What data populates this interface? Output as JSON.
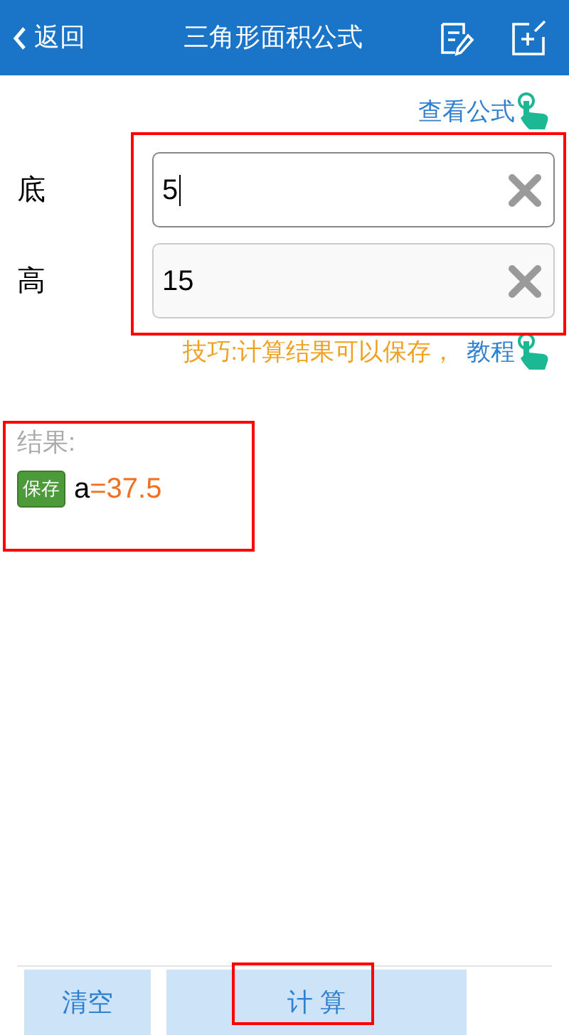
{
  "nav_bar": {
    "back": "返回",
    "title": "三角形面积公式"
  },
  "formula_link": "查看公式",
  "fields": [
    {
      "label": "底",
      "value": "5",
      "focused": true
    },
    {
      "label": "高",
      "value": "15",
      "focused": false
    }
  ],
  "tip": {
    "text": "技巧:计算结果可以保存，",
    "link": "教程"
  },
  "result": {
    "label": "结果:",
    "save": "保存",
    "variable": "a",
    "equals": "=37.5"
  },
  "buttons": [
    {
      "label": "清空",
      "kind": "clear"
    },
    {
      "label": "计 算",
      "kind": "calc"
    }
  ]
}
